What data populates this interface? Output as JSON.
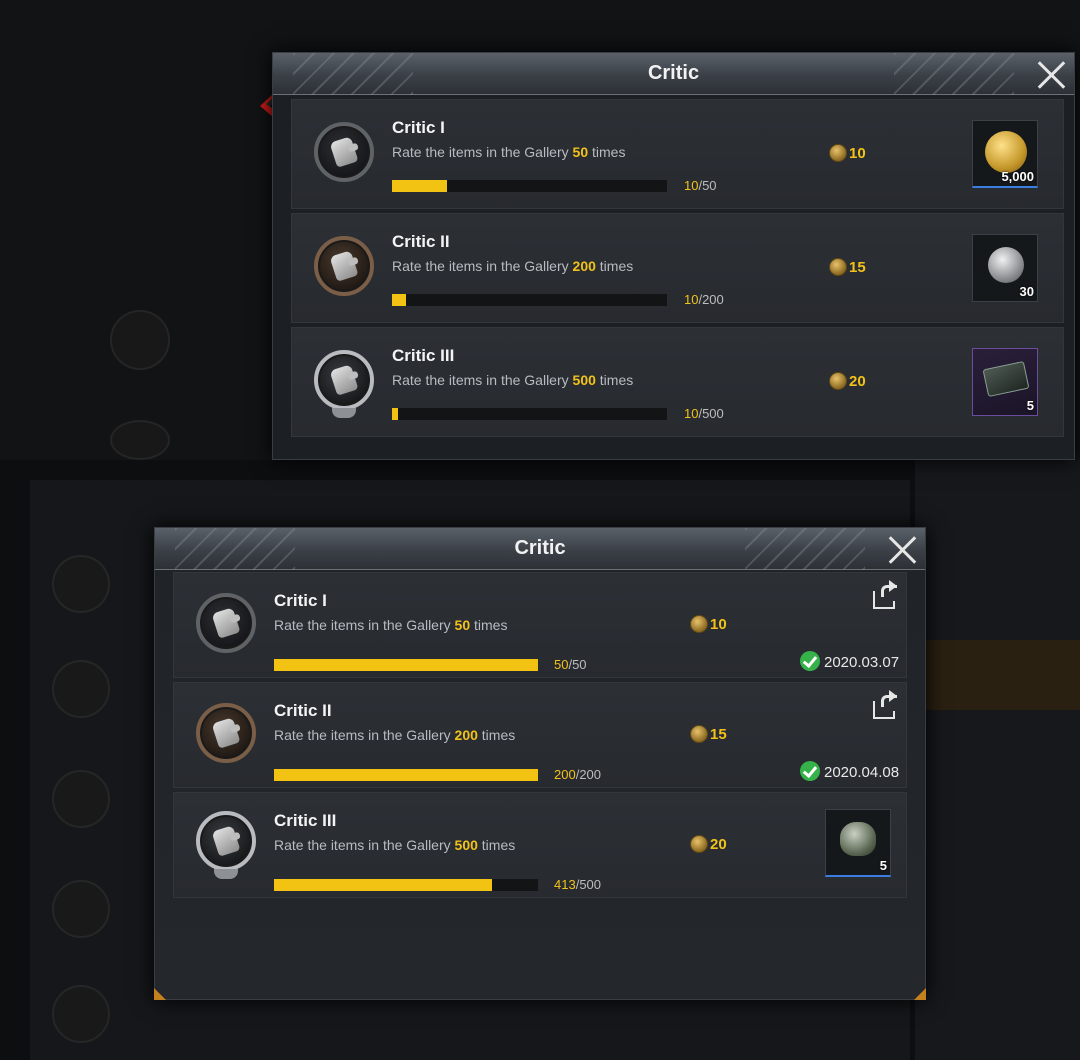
{
  "top_dialog": {
    "title": "Critic",
    "rows": [
      {
        "title": "Critic I",
        "desc_prefix": "Rate the items in the Gallery ",
        "target": "50",
        "desc_suffix": " times",
        "progress_current": "10",
        "progress_total": "/50",
        "progress_fraction": 0.2,
        "points": "10",
        "reward_qty": "5,000",
        "reward_icon": "gold-coin-icon"
      },
      {
        "title": "Critic II",
        "desc_prefix": "Rate the items in the Gallery ",
        "target": "200",
        "desc_suffix": " times",
        "progress_current": "10",
        "progress_total": "/200",
        "progress_fraction": 0.05,
        "points": "15",
        "reward_qty": "30",
        "reward_icon": "silver-coin-icon"
      },
      {
        "title": "Critic III",
        "desc_prefix": "Rate the items in the Gallery ",
        "target": "500",
        "desc_suffix": " times",
        "progress_current": "10",
        "progress_total": "/500",
        "progress_fraction": 0.02,
        "points": "20",
        "reward_qty": "5",
        "reward_icon": "crate-icon"
      }
    ]
  },
  "bottom_dialog": {
    "title": "Critic",
    "rows": [
      {
        "title": "Critic I",
        "desc_prefix": "Rate the items in the Gallery ",
        "target": "50",
        "desc_suffix": " times",
        "progress_current": "50",
        "progress_total": "/50",
        "progress_fraction": 1.0,
        "points": "10",
        "completed_date": "2020.03.07"
      },
      {
        "title": "Critic II",
        "desc_prefix": "Rate the items in the Gallery ",
        "target": "200",
        "desc_suffix": " times",
        "progress_current": "200",
        "progress_total": "/200",
        "progress_fraction": 1.0,
        "points": "15",
        "completed_date": "2020.04.08"
      },
      {
        "title": "Critic III",
        "desc_prefix": "Rate the items in the Gallery ",
        "target": "500",
        "desc_suffix": " times",
        "progress_current": "413",
        "progress_total": "/500",
        "progress_fraction": 0.826,
        "points": "20",
        "reward_qty": "5",
        "reward_icon": "helmet-icon"
      }
    ]
  },
  "colors": {
    "accent_yellow": "#f3c314",
    "check_green": "#35b24a",
    "pointer_red": "#d11a1a"
  }
}
